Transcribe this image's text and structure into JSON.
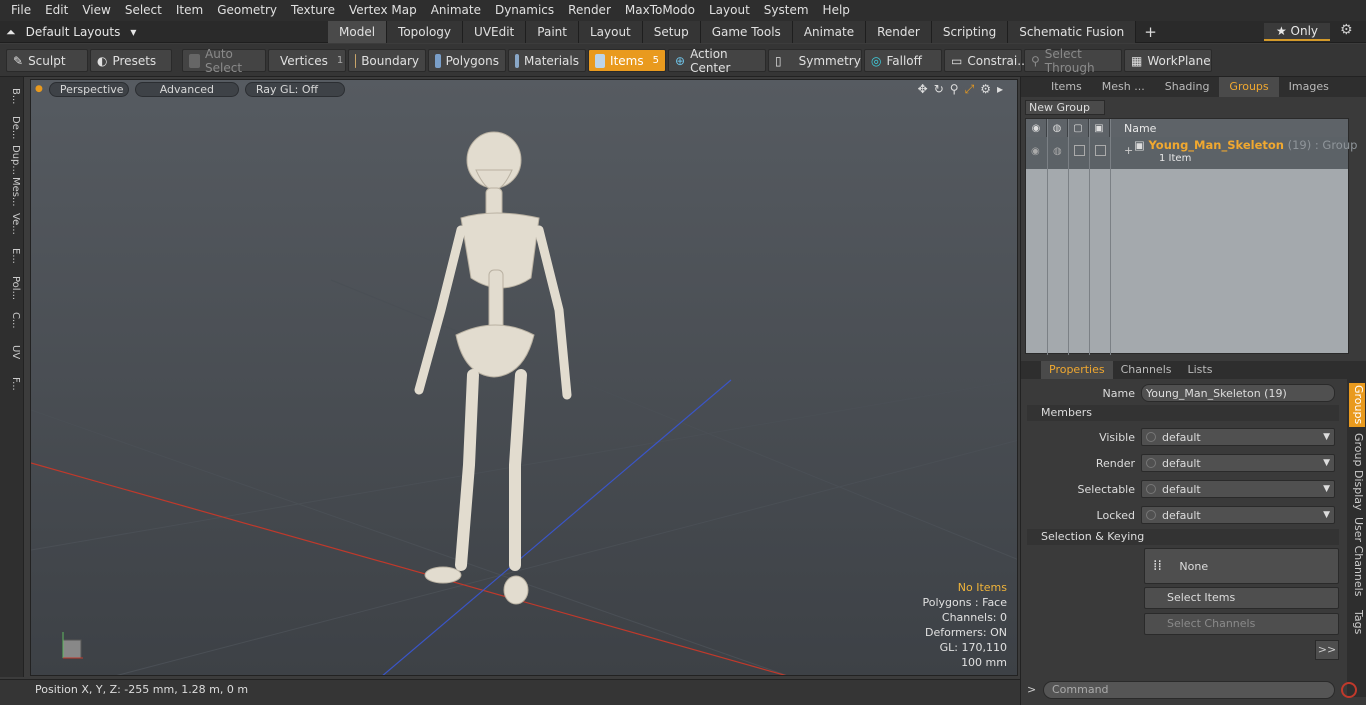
{
  "menu": [
    "File",
    "Edit",
    "View",
    "Select",
    "Item",
    "Geometry",
    "Texture",
    "Vertex Map",
    "Animate",
    "Dynamics",
    "Render",
    "MaxToModo",
    "Layout",
    "System",
    "Help"
  ],
  "layouts_label": "Default Layouts",
  "tabs": [
    "Model",
    "Topology",
    "UVEdit",
    "Paint",
    "Layout",
    "Setup",
    "Game Tools",
    "Animate",
    "Render",
    "Scripting",
    "Schematic Fusion"
  ],
  "tab_plus": "+",
  "only_label": "Only",
  "toolbar": {
    "sculpt": "Sculpt",
    "presets": "Presets",
    "auto_select": "Auto Select",
    "vertices": "Vertices",
    "vertices_count": "1",
    "boundary": "Boundary",
    "polygons": "Polygons",
    "materials": "Materials",
    "items": "Items",
    "items_count": "5",
    "action_center": "Action Center",
    "symmetry": "Symmetry",
    "falloff": "Falloff",
    "constraints": "Constrai...",
    "select_through": "Select Through",
    "workplane": "WorkPlane"
  },
  "left_tabs": [
    "B...",
    "De...",
    "Dup...",
    "Mes...",
    "Ve...",
    "E...",
    "Pol...",
    "C...",
    "UV",
    "F..."
  ],
  "viewport": {
    "perspective": "Perspective",
    "advanced": "Advanced",
    "raygl": "Ray GL: Off"
  },
  "stats": {
    "no_items": "No Items",
    "polygons": "Polygons : Face",
    "channels": "Channels: 0",
    "deformers": "Deformers: ON",
    "gl": "GL: 170,110",
    "scale": "100 mm"
  },
  "status": "Position X, Y, Z:  -255 mm, 1.28 m, 0 m",
  "right_tabs": [
    "Items",
    "Mesh ...",
    "Shading",
    "Groups",
    "Images"
  ],
  "new_group": "New Group",
  "grid": {
    "name_header": "Name",
    "group_name": "Young_Man_Skeleton",
    "group_count": "(19)",
    "group_type": ": Group",
    "group_items": "1 Item"
  },
  "props_tabs": [
    "Properties",
    "Channels",
    "Lists"
  ],
  "props": {
    "name_label": "Name",
    "name_value": "Young_Man_Skeleton (19)",
    "members": "Members",
    "visible": "Visible",
    "render": "Render",
    "selectable": "Selectable",
    "locked": "Locked",
    "default_value": "default",
    "sel_keying": "Selection & Keying",
    "none": "None",
    "select_items": "Select Items",
    "select_channels": "Select Channels",
    "more": ">>"
  },
  "side_tabs": [
    "Groups",
    "Group Display",
    "User Channels",
    "Tags"
  ],
  "command_placeholder": "Command"
}
